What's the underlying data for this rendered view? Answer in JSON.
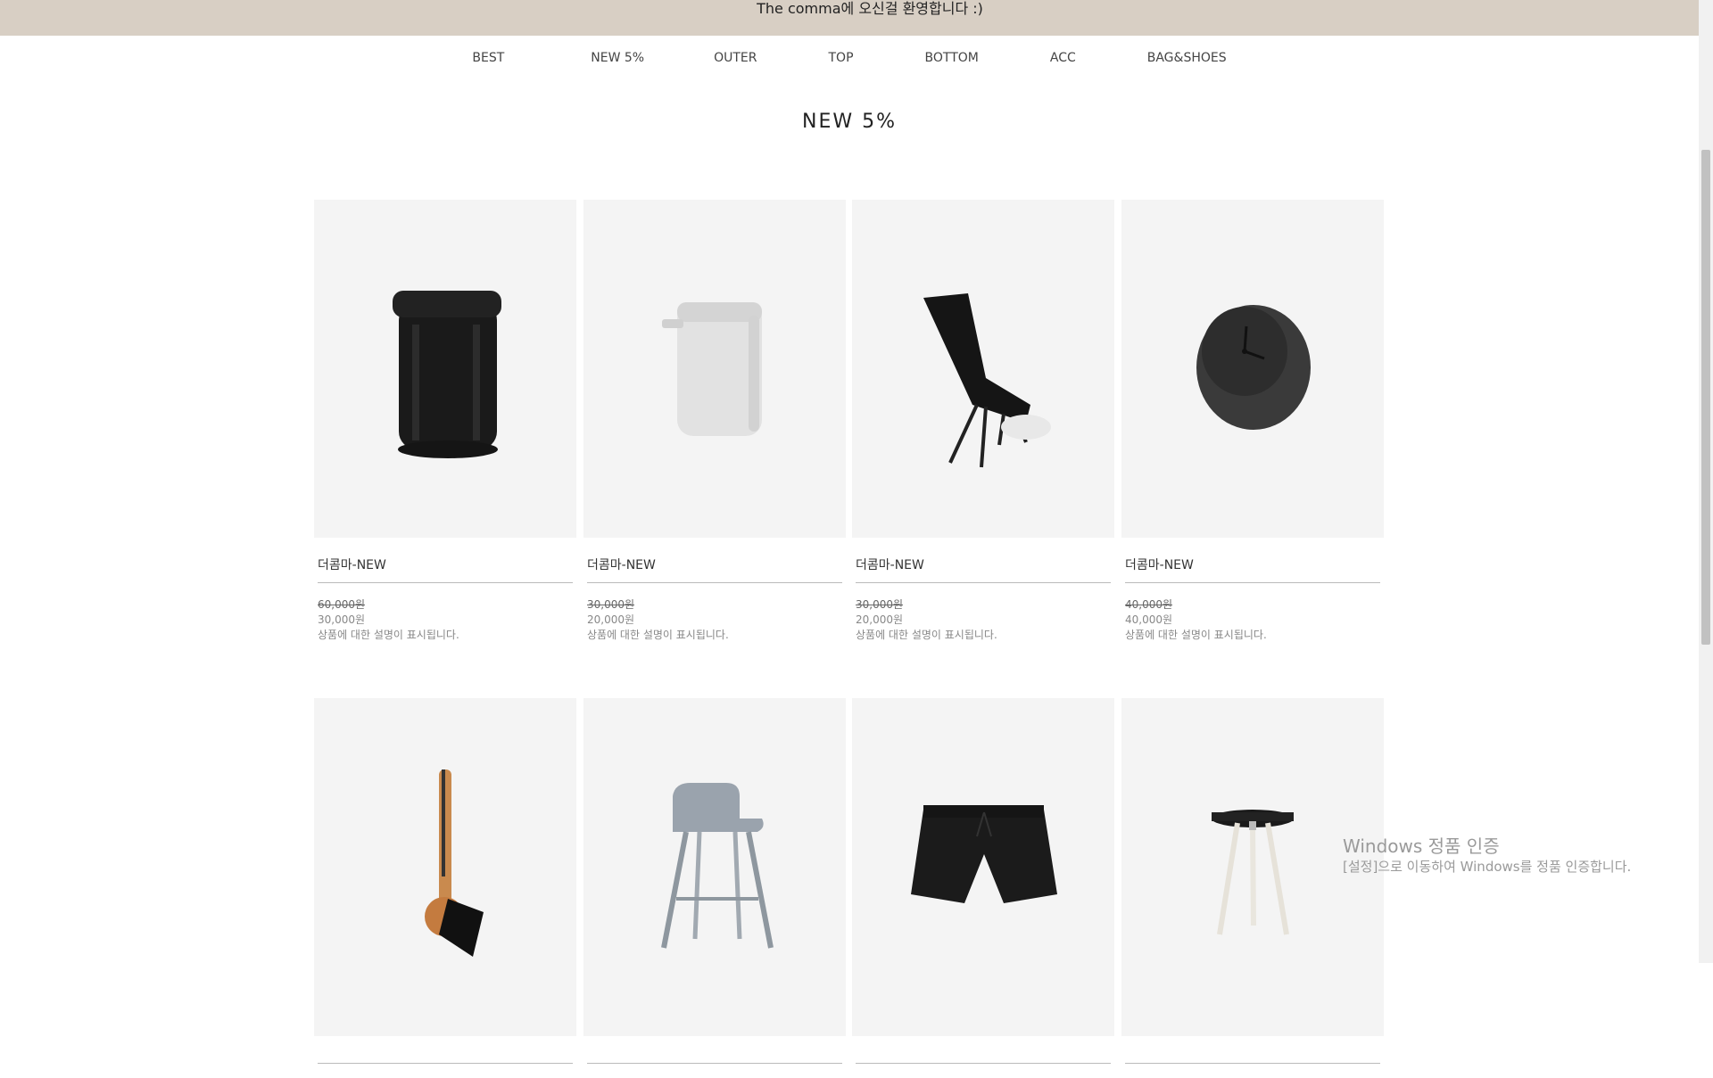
{
  "header": {
    "welcome": "The comma에 오신걸 환영합니다 :)"
  },
  "nav": {
    "items": [
      {
        "label": "BEST"
      },
      {
        "label": "NEW 5%"
      },
      {
        "label": "OUTER"
      },
      {
        "label": "TOP"
      },
      {
        "label": "BOTTOM"
      },
      {
        "label": "ACC"
      },
      {
        "label": "BAG&SHOES"
      }
    ]
  },
  "main": {
    "title": "NEW 5%",
    "products": [
      {
        "image": "black-backpack",
        "name": "더콤마-NEW",
        "original_price": "60,000원",
        "price": "30,000원",
        "description": "상품에 대한 설명이 표시됩니다."
      },
      {
        "image": "white-soap-dispenser",
        "name": "더콤마-NEW",
        "original_price": "30,000원",
        "price": "20,000원",
        "description": "상품에 대한 설명이 표시됩니다."
      },
      {
        "image": "black-camping-chair",
        "name": "더콤마-NEW",
        "original_price": "30,000원",
        "price": "20,000원",
        "description": "상품에 대한 설명이 표시됩니다."
      },
      {
        "image": "dark-table-clock",
        "name": "더콤마-NEW",
        "original_price": "40,000원",
        "price": "40,000원",
        "description": "상품에 대한 설명이 표시됩니다."
      },
      {
        "image": "wooden-dish-brush",
        "name": "",
        "original_price": "",
        "price": "",
        "description": ""
      },
      {
        "image": "grey-bar-stool",
        "name": "",
        "original_price": "",
        "price": "",
        "description": ""
      },
      {
        "image": "black-shorts",
        "name": "",
        "original_price": "",
        "price": "",
        "description": ""
      },
      {
        "image": "tripod-side-table",
        "name": "",
        "original_price": "",
        "price": "",
        "description": ""
      }
    ]
  },
  "os_watermark": {
    "title": "Windows 정품 인증",
    "subtitle": "[설정]으로 이동하여 Windows를 정품 인증합니다."
  }
}
